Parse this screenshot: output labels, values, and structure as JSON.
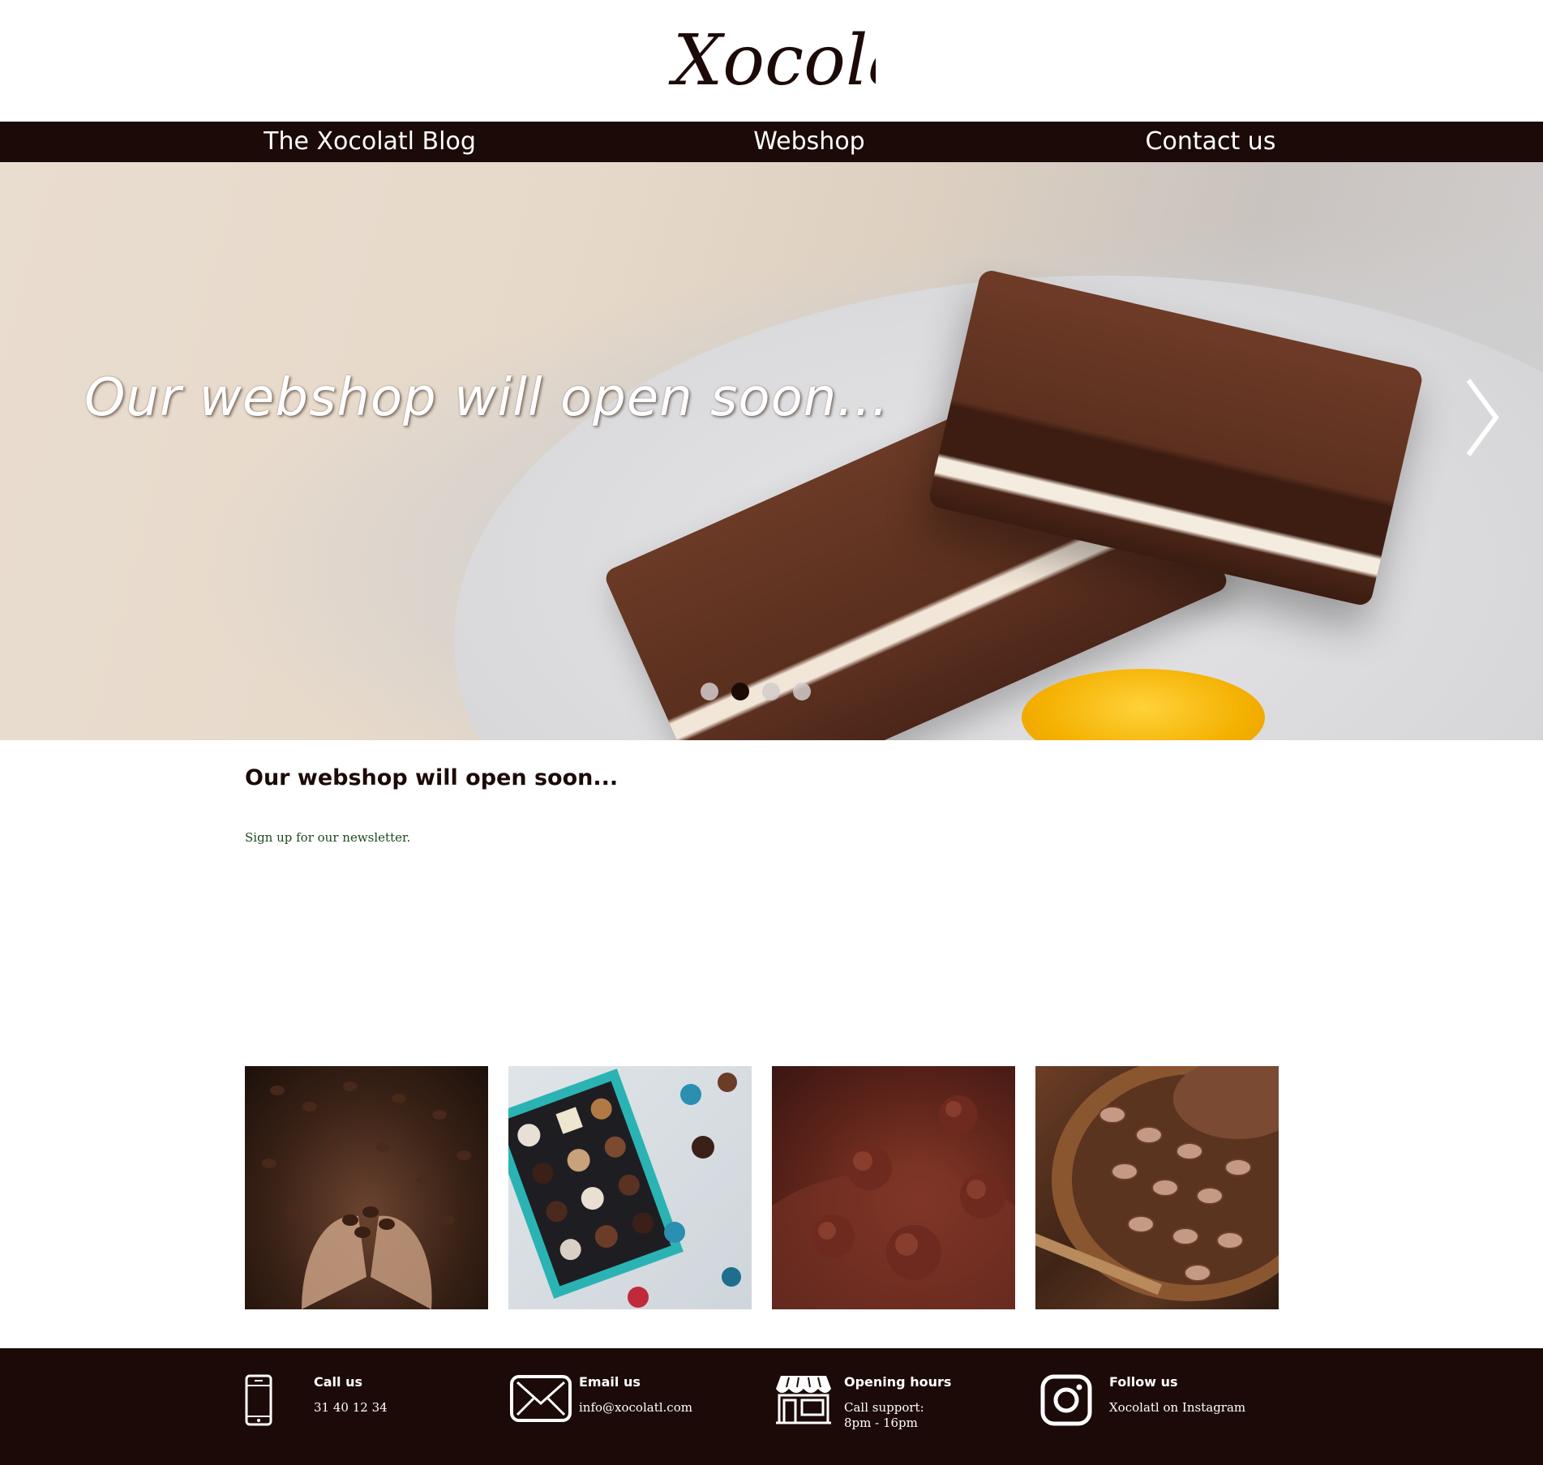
{
  "logo": {
    "text": "Xocolatl"
  },
  "nav": {
    "items": [
      {
        "label": "The Xocolatl Blog"
      },
      {
        "label": "Webshop"
      },
      {
        "label": "Contact us"
      }
    ]
  },
  "hero": {
    "caption": "Our webshop will open soon...",
    "next_icon": "chevron-right-icon",
    "slide_count": 4,
    "active_slide": 2
  },
  "content": {
    "title": "Our webshop will open soon...",
    "newsletter_link": "Sign up for our newsletter."
  },
  "gallery": {
    "images": [
      "cocoa-beans-in-hands",
      "chocolate-box",
      "cocoa-truffles",
      "cocoa-beans-bowl"
    ]
  },
  "footer": {
    "call": {
      "icon": "phone-icon",
      "title": "Call us",
      "text": "31 40 12 34"
    },
    "email": {
      "icon": "envelope-icon",
      "title": "Email us",
      "text": "info@xocolatl.com"
    },
    "hours": {
      "icon": "store-icon",
      "title": "Opening hours",
      "line1": "Call support:",
      "line2": "8pm - 16pm"
    },
    "follow": {
      "icon": "instagram-icon",
      "title": "Follow us",
      "text": "Xocolatl on Instagram"
    }
  },
  "colors": {
    "brand_dark": "#1c0a08",
    "link_green": "#1c4a1c",
    "white": "#ffffff"
  }
}
